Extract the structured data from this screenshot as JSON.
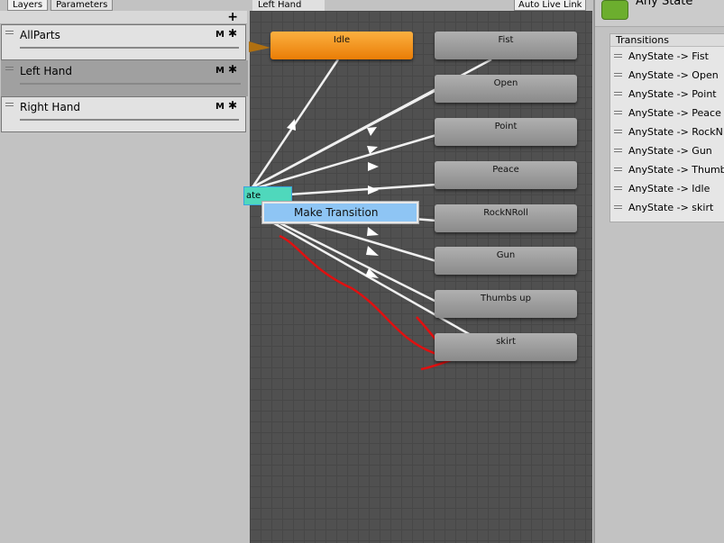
{
  "layers_panel": {
    "tabs": [
      "Layers",
      "Parameters"
    ],
    "add_label": "+",
    "layers": [
      {
        "name": "AllParts",
        "m": "M",
        "gear": "✱"
      },
      {
        "name": "Left Hand",
        "m": "M",
        "gear": "✱"
      },
      {
        "name": "Right Hand",
        "m": "M",
        "gear": "✱"
      }
    ]
  },
  "graph": {
    "breadcrumb": "Left Hand",
    "auto_live_link": "Auto Live Link",
    "any_state_label": "ate",
    "context_menu": "Make Transition",
    "states": [
      "Idle",
      "Fist",
      "Open",
      "Point",
      "Peace",
      "RockNRoll",
      "Gun",
      "Thumbs up",
      "skirt"
    ]
  },
  "inspector": {
    "title": "Any State",
    "transitions_header": "Transitions",
    "transitions": [
      "AnyState -> Fist",
      "AnyState -> Open",
      "AnyState -> Point",
      "AnyState -> Peace",
      "AnyState -> RockNRoll",
      "AnyState -> Gun",
      "AnyState -> Thumbs up",
      "AnyState -> Idle",
      "AnyState -> skirt"
    ]
  },
  "colors": {
    "default_state": "#ea7d06",
    "any_state": "#4fd8bc",
    "annotation": "#e01010"
  }
}
